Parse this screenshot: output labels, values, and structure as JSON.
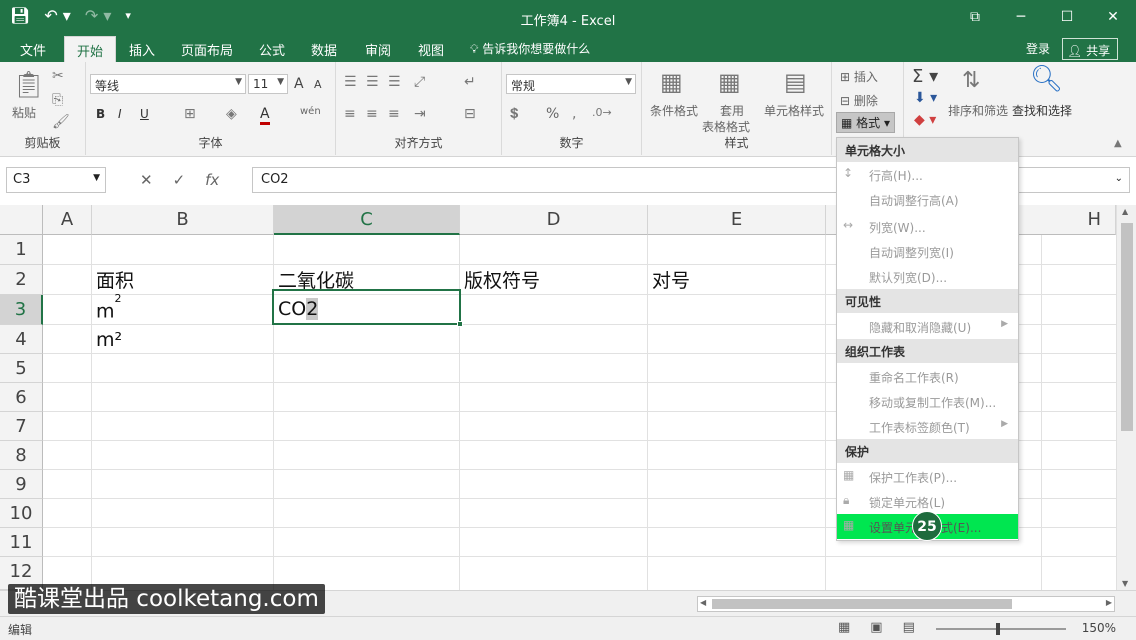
{
  "window": {
    "title": "工作簿4 - Excel",
    "restore_icon": "ribbon-display-icon",
    "controls": [
      "─",
      "☐",
      "✕"
    ]
  },
  "tabs": {
    "items": [
      "文件",
      "开始",
      "插入",
      "页面布局",
      "公式",
      "数据",
      "审阅",
      "视图"
    ],
    "active": "开始",
    "tell_me": "告诉我你想要做什么",
    "login": "登录",
    "share": "共享"
  },
  "ribbon": {
    "clipboard": {
      "paste": "粘贴",
      "group": "剪贴板"
    },
    "font": {
      "name": "等线",
      "size": "11",
      "group": "字体",
      "bold": "B",
      "italic": "I",
      "underline": "U",
      "grow": "A",
      "shrink": "A",
      "phonetic": "wén",
      "color_letter": "A"
    },
    "alignment": {
      "group": "对齐方式"
    },
    "number": {
      "format": "常规",
      "group": "数字",
      "percent": "%"
    },
    "styles": {
      "conditional": "条件格式",
      "table_line1": "套用",
      "table_line2": "表格格式",
      "cell_styles": "单元格样式",
      "group": "样式"
    },
    "cells": {
      "insert": "插入",
      "delete": "删除",
      "format": "格式"
    },
    "editing": {
      "sort": "排序和筛选",
      "find": "查找和选择"
    }
  },
  "formula_bar": {
    "name_box": "C3",
    "value": "CO2",
    "cancel": "✕",
    "enter": "✓",
    "fx": "fx"
  },
  "grid": {
    "columns": [
      "A",
      "B",
      "C",
      "D",
      "E",
      "H"
    ],
    "selected_column": "C",
    "rows": [
      "1",
      "2",
      "3",
      "4",
      "5",
      "6",
      "7",
      "8",
      "9",
      "10",
      "11",
      "12"
    ],
    "selected_row": "3",
    "cells": {
      "B2": "面积",
      "C2": "二氧化碳",
      "D2": "版权符号",
      "E2": "对号",
      "B3_base": "m",
      "B3_sup": "2",
      "C3_main": "CO",
      "C3_hl": "2",
      "B4": "m²"
    }
  },
  "menu": {
    "sections": {
      "size": "单元格大小",
      "visibility": "可见性",
      "organize": "组织工作表",
      "protect": "保护"
    },
    "items": {
      "row_height": "行高(H)...",
      "autofit_row": "自动调整行高(A)",
      "col_width": "列宽(W)...",
      "autofit_col": "自动调整列宽(I)",
      "default_width": "默认列宽(D)...",
      "hide_unhide": "隐藏和取消隐藏(U)",
      "rename": "重命名工作表(R)",
      "move_copy": "移动或复制工作表(M)...",
      "tab_color": "工作表标签颜色(T)",
      "protect_sheet": "保护工作表(P)...",
      "lock_cell": "锁定单元格(L)",
      "format_cells": "设置单元格格式(E)..."
    },
    "hot_item": "format_cells",
    "hot_color": "#00e650"
  },
  "badge": "25",
  "status": {
    "mode": "编辑",
    "zoom": "150%"
  },
  "watermark": "酷课堂出品 coolketang.com",
  "colors": {
    "excel_green": "#217346",
    "ribbon_bg": "#f3f3f3"
  }
}
